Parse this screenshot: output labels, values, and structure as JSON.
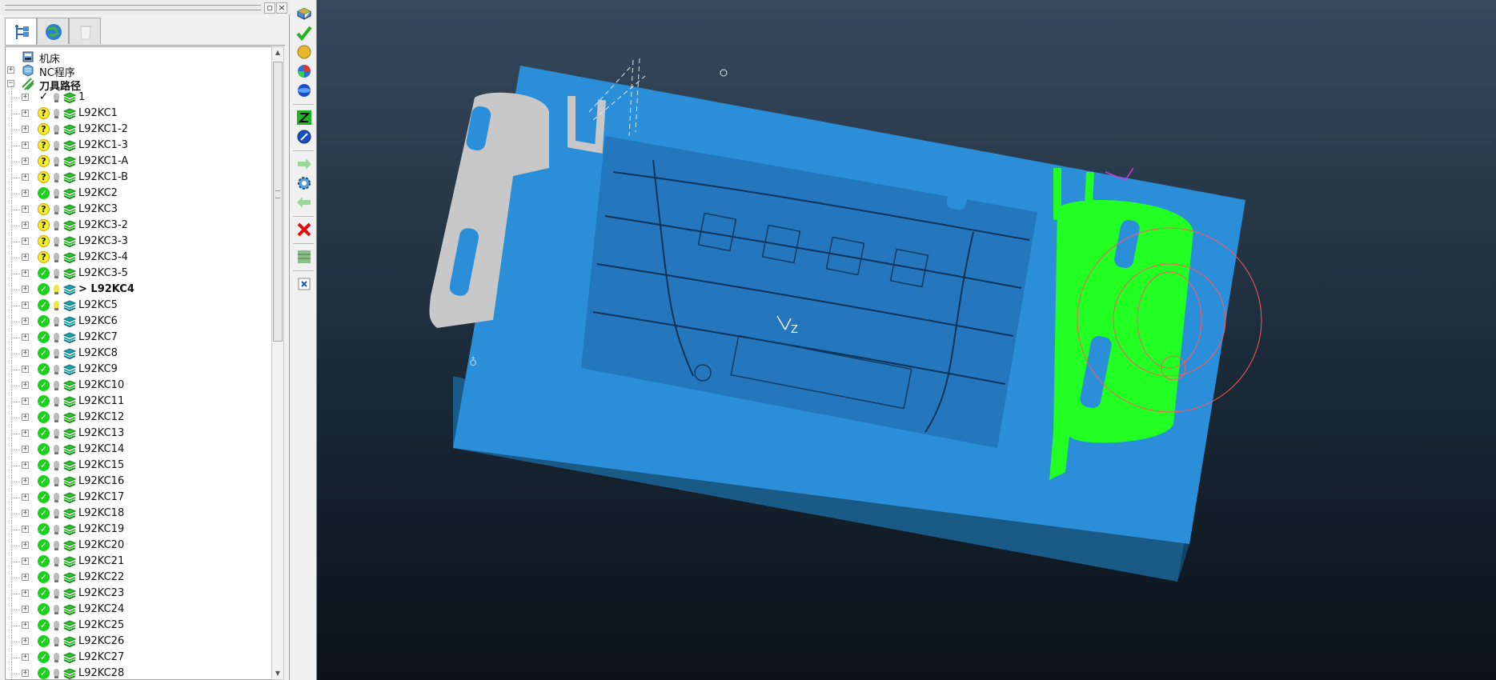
{
  "explorer": {
    "tabs": [
      {
        "name": "tree-view",
        "icon": "tree-icon",
        "active": true
      },
      {
        "name": "globe-view",
        "icon": "globe-icon",
        "active": false
      },
      {
        "name": "recycle-bin-view",
        "icon": "recycle-bin-icon",
        "active": false
      }
    ],
    "tree": {
      "machine": "机床",
      "nc_programs": "NC程序",
      "toolpaths": "刀具路径",
      "items": [
        {
          "label": "1",
          "status": "plain",
          "bulb": "off",
          "stack": "green"
        },
        {
          "label": "L92KC1",
          "status": "question",
          "bulb": "off",
          "stack": "green"
        },
        {
          "label": "L92KC1-2",
          "status": "question",
          "bulb": "off",
          "stack": "green"
        },
        {
          "label": "L92KC1-3",
          "status": "question",
          "bulb": "off",
          "stack": "green"
        },
        {
          "label": "L92KC1-A",
          "status": "question",
          "bulb": "off",
          "stack": "green"
        },
        {
          "label": "L92KC1-B",
          "status": "question",
          "bulb": "off",
          "stack": "green"
        },
        {
          "label": "L92KC2",
          "status": "check",
          "bulb": "off",
          "stack": "green"
        },
        {
          "label": "L92KC3",
          "status": "question",
          "bulb": "off",
          "stack": "green"
        },
        {
          "label": "L92KC3-2",
          "status": "question",
          "bulb": "off",
          "stack": "green"
        },
        {
          "label": "L92KC3-3",
          "status": "question",
          "bulb": "off",
          "stack": "green"
        },
        {
          "label": "L92KC3-4",
          "status": "question",
          "bulb": "off",
          "stack": "green"
        },
        {
          "label": "L92KC3-5",
          "status": "check",
          "bulb": "off",
          "stack": "green"
        },
        {
          "label": "> L92KC4",
          "status": "check",
          "bulb": "on",
          "stack": "teal",
          "bold": true
        },
        {
          "label": "L92KC5",
          "status": "check",
          "bulb": "on",
          "stack": "teal"
        },
        {
          "label": "L92KC6",
          "status": "check",
          "bulb": "off",
          "stack": "teal"
        },
        {
          "label": "L92KC7",
          "status": "check",
          "bulb": "off",
          "stack": "teal"
        },
        {
          "label": "L92KC8",
          "status": "check",
          "bulb": "off",
          "stack": "teal"
        },
        {
          "label": "L92KC9",
          "status": "check",
          "bulb": "off",
          "stack": "teal"
        },
        {
          "label": "L92KC10",
          "status": "check",
          "bulb": "off",
          "stack": "green"
        },
        {
          "label": "L92KC11",
          "status": "check",
          "bulb": "off",
          "stack": "green"
        },
        {
          "label": "L92KC12",
          "status": "check",
          "bulb": "off",
          "stack": "green"
        },
        {
          "label": "L92KC13",
          "status": "check",
          "bulb": "off",
          "stack": "green"
        },
        {
          "label": "L92KC14",
          "status": "check",
          "bulb": "off",
          "stack": "green"
        },
        {
          "label": "L92KC15",
          "status": "check",
          "bulb": "off",
          "stack": "green"
        },
        {
          "label": "L92KC16",
          "status": "check",
          "bulb": "off",
          "stack": "green"
        },
        {
          "label": "L92KC17",
          "status": "check",
          "bulb": "off",
          "stack": "green"
        },
        {
          "label": "L92KC18",
          "status": "check",
          "bulb": "off",
          "stack": "green"
        },
        {
          "label": "L92KC19",
          "status": "check",
          "bulb": "off",
          "stack": "green"
        },
        {
          "label": "L92KC20",
          "status": "check",
          "bulb": "off",
          "stack": "green"
        },
        {
          "label": "L92KC21",
          "status": "check",
          "bulb": "off",
          "stack": "green"
        },
        {
          "label": "L92KC22",
          "status": "check",
          "bulb": "off",
          "stack": "green"
        },
        {
          "label": "L92KC23",
          "status": "check",
          "bulb": "off",
          "stack": "green"
        },
        {
          "label": "L92KC24",
          "status": "check",
          "bulb": "off",
          "stack": "green"
        },
        {
          "label": "L92KC25",
          "status": "check",
          "bulb": "off",
          "stack": "green"
        },
        {
          "label": "L92KC26",
          "status": "check",
          "bulb": "off",
          "stack": "green"
        },
        {
          "label": "L92KC27",
          "status": "check",
          "bulb": "off",
          "stack": "green"
        },
        {
          "label": "L92KC28",
          "status": "check",
          "bulb": "off",
          "stack": "green"
        }
      ]
    }
  },
  "toolbar": {
    "tools": [
      {
        "icon": "stock-icon"
      },
      {
        "icon": "check-icon"
      },
      {
        "icon": "sphere-icon"
      },
      {
        "icon": "shaded-ball-icon"
      },
      {
        "icon": "blue-ball-icon"
      },
      {
        "sep": true
      },
      {
        "icon": "z-axis-icon"
      },
      {
        "icon": "compass-icon"
      },
      {
        "sep": true
      },
      {
        "icon": "arrow-right-icon"
      },
      {
        "icon": "gear-icon"
      },
      {
        "icon": "arrow-left-icon"
      },
      {
        "sep": true
      },
      {
        "icon": "red-x-icon"
      },
      {
        "sep": true
      },
      {
        "icon": "layers-icon"
      },
      {
        "sep": true
      },
      {
        "icon": "small-x-icon"
      }
    ]
  },
  "viewport": {
    "axis_label": "Z",
    "colors": {
      "part": "#2a8fd8",
      "side": "#17537d",
      "toolpath_done": "#c8c8c8",
      "toolpath_active": "#22ff22",
      "tool_circles": "#ff5a5a",
      "background_top": "#36495c",
      "background_bottom": "#0a1119"
    }
  }
}
